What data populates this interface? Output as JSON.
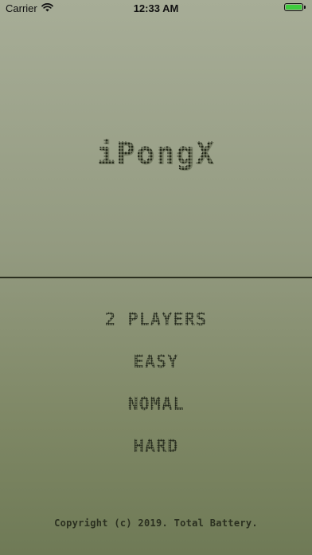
{
  "status_bar": {
    "carrier": "Carrier",
    "time": "12:33 AM",
    "wifi_icon": "wifi-icon",
    "battery_icon": "battery-icon",
    "battery_level": 1.0,
    "battery_color": "#3ecb3e"
  },
  "title": "iPongX",
  "menu": {
    "two_players": "2 PLAYERS",
    "easy": "EASY",
    "normal": "NOMAL",
    "hard": "HARD"
  },
  "footer": {
    "copyright": "Copyright (c) 2019. Total Battery."
  },
  "colors": {
    "background_top": "#a7ad97",
    "background_bottom": "#6f7a56",
    "text_dark": "#1f2418"
  }
}
